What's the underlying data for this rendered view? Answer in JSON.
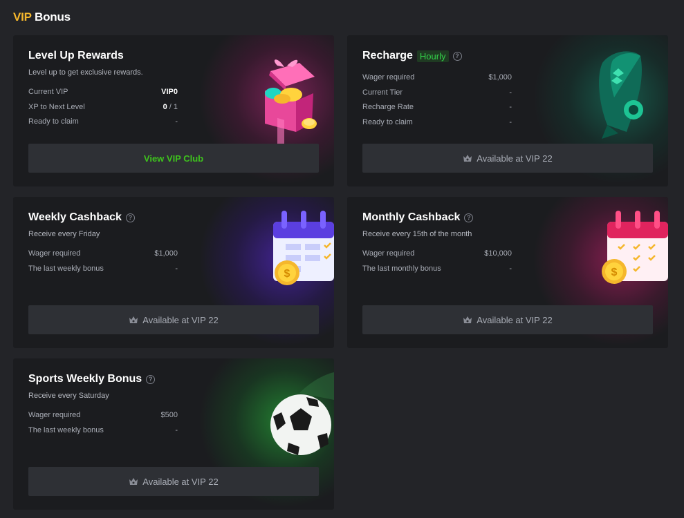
{
  "page": {
    "title_vip": "VIP",
    "title_bonus": "Bonus"
  },
  "colors": {
    "accent_gold": "#f5b72c",
    "accent_green": "#3ec21d",
    "card_bg": "#1b1c1f",
    "page_bg": "#232428"
  },
  "cards": {
    "level_up": {
      "title": "Level Up Rewards",
      "subtitle": "Level up to get exclusive rewards.",
      "rows": [
        {
          "label": "Current VIP",
          "value": "VIP0"
        },
        {
          "label": "XP to Next Level",
          "value_current": "0",
          "value_rest": " / 1"
        },
        {
          "label": "Ready to claim",
          "value": "-"
        }
      ],
      "button": "View VIP Club",
      "icon": "gift-box-icon"
    },
    "recharge": {
      "title": "Recharge",
      "tag": "Hourly",
      "rows": [
        {
          "label": "Wager required",
          "value": "$1,000"
        },
        {
          "label": "Current Tier",
          "value": "-"
        },
        {
          "label": "Recharge Rate",
          "value": "-"
        },
        {
          "label": "Ready to claim",
          "value": "-"
        }
      ],
      "button": "Available at VIP 22",
      "icon": "rocket-icon"
    },
    "weekly_cashback": {
      "title": "Weekly Cashback",
      "subtitle": "Receive every Friday",
      "rows": [
        {
          "label": "Wager required",
          "value": "$1,000"
        },
        {
          "label": "The last weekly bonus",
          "value": "-"
        }
      ],
      "button": "Available at VIP 22",
      "icon": "calendar-coin-icon"
    },
    "monthly_cashback": {
      "title": "Monthly Cashback",
      "subtitle": "Receive every 15th of the month",
      "rows": [
        {
          "label": "Wager required",
          "value": "$10,000"
        },
        {
          "label": "The last monthly bonus",
          "value": "-"
        }
      ],
      "button": "Available at VIP 22",
      "icon": "calendar-coin-icon"
    },
    "sports_weekly": {
      "title": "Sports Weekly Bonus",
      "subtitle": "Receive every Saturday",
      "rows": [
        {
          "label": "Wager required",
          "value": "$500"
        },
        {
          "label": "The last weekly bonus",
          "value": "-"
        }
      ],
      "button": "Available at VIP 22",
      "icon": "soccer-ball-icon"
    }
  }
}
